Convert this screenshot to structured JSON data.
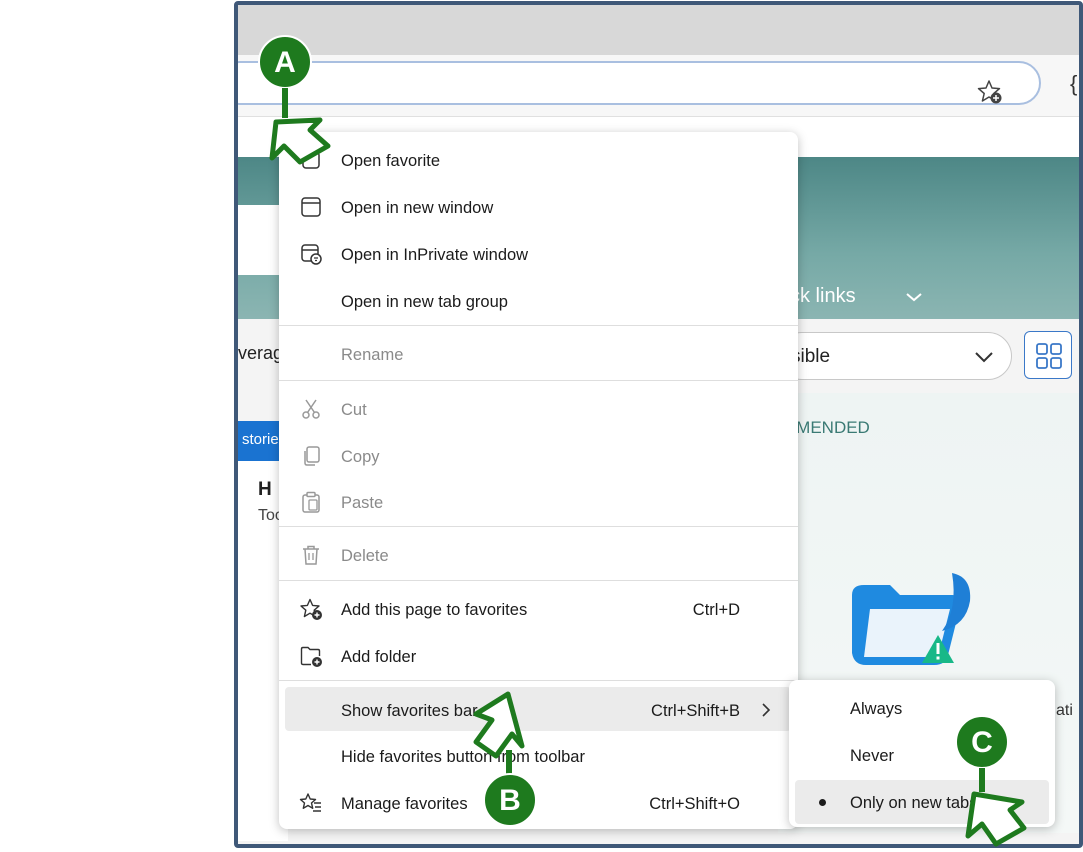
{
  "background_page": {
    "quick_links_label": "ck links",
    "left_select_fragment": "verag",
    "right_select_fragment": "sible",
    "stories_fragment": "storie",
    "card_heading_fragment": "H",
    "card_text_fragment": "Too",
    "recommended_fragment": "MMENDED",
    "right_card_fragment": "ati"
  },
  "context_menu": {
    "items": [
      {
        "label": "Open favorite",
        "icon": "open-favorite-icon"
      },
      {
        "label": "Open in new window",
        "icon": "window-icon"
      },
      {
        "label": "Open in InPrivate window",
        "icon": "inprivate-window-icon"
      },
      {
        "label": "Open in new tab group",
        "icon": ""
      },
      {
        "label": "Rename",
        "icon": "",
        "disabled": true
      },
      {
        "label": "Cut",
        "icon": "scissors-icon",
        "disabled": true
      },
      {
        "label": "Copy",
        "icon": "copy-icon",
        "disabled": true
      },
      {
        "label": "Paste",
        "icon": "paste-icon",
        "disabled": true
      },
      {
        "label": "Delete",
        "icon": "trash-icon",
        "disabled": true
      },
      {
        "label": "Add this page to favorites",
        "icon": "star-add-icon",
        "shortcut": "Ctrl+D"
      },
      {
        "label": "Add folder",
        "icon": "folder-add-icon"
      },
      {
        "label": "Show favorites bar",
        "icon": "",
        "shortcut": "Ctrl+Shift+B",
        "has_submenu": true,
        "highlighted": true
      },
      {
        "label": "Hide favorites button from toolbar",
        "icon": ""
      },
      {
        "label": "Manage favorites",
        "icon": "manage-favorites-icon",
        "shortcut": "Ctrl+Shift+O"
      }
    ]
  },
  "favorites_bar_submenu": {
    "items": [
      {
        "label": "Always",
        "selected": false
      },
      {
        "label": "Never",
        "selected": false
      },
      {
        "label": "Only on new tabs",
        "selected": true
      }
    ]
  },
  "callouts": {
    "a": "A",
    "b": "B",
    "c": "C",
    "color": "#1e7a1e"
  },
  "colors": {
    "frame_border": "#3f5878",
    "hero_teal": "#5f9694",
    "stories_blue": "#1a73d1",
    "highlight": "#ebebeb"
  }
}
